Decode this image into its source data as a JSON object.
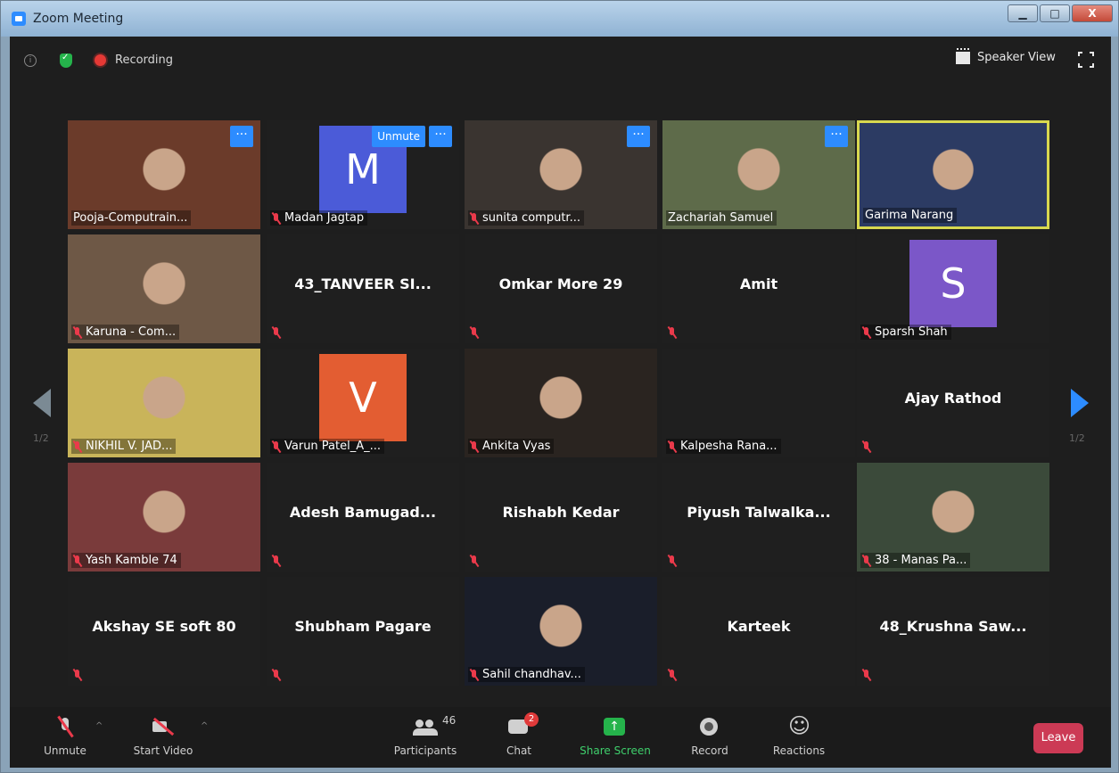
{
  "window": {
    "title": "Zoom Meeting",
    "controls": {
      "minimize": "▁",
      "maximize": "□",
      "close": "X"
    }
  },
  "topbar": {
    "recording_label": "Recording",
    "speaker_view_label": "Speaker View"
  },
  "gallery": {
    "page_indicator_left": "1/2",
    "page_indicator_right": "1/2",
    "tiles": [
      {
        "name": "Pooja-Computrain...",
        "kind": "video",
        "muted": false,
        "more": true,
        "bg": "#6b3b2a"
      },
      {
        "name": "Madan Jagtap",
        "kind": "avatar",
        "letter": "M",
        "color": "#4b5bd8",
        "muted": true,
        "more": true,
        "unmute": "Unmute"
      },
      {
        "name": "sunita computr...",
        "kind": "video",
        "muted": true,
        "more": true,
        "bg": "#3a3430"
      },
      {
        "name": "Zachariah Samuel",
        "kind": "video",
        "muted": false,
        "more": true,
        "bg": "#5e6b4a"
      },
      {
        "name": "Garima Narang",
        "kind": "video",
        "muted": false,
        "more": false,
        "active": true,
        "bg": "#2c3b63"
      },
      {
        "name": "Karuna - Com...",
        "kind": "video",
        "muted": true,
        "more": false,
        "bg": "#6e5846"
      },
      {
        "name": "43_TANVEER SI...",
        "kind": "name",
        "muted": true
      },
      {
        "name": "Omkar More 29",
        "kind": "name",
        "muted": true
      },
      {
        "name": "Amit",
        "kind": "name",
        "muted": true
      },
      {
        "name": "Sparsh Shah",
        "kind": "avatar",
        "letter": "S",
        "color": "#7b57c8",
        "muted": true
      },
      {
        "name": "NIKHIL V. JAD...",
        "kind": "video",
        "muted": true,
        "more": false,
        "bg": "#c9b45a"
      },
      {
        "name": "Varun Patel_A_...",
        "kind": "avatar",
        "letter": "V",
        "color": "#e35d32",
        "muted": true
      },
      {
        "name": "Ankita Vyas",
        "kind": "video",
        "muted": true,
        "more": false,
        "bg": "#2a2420"
      },
      {
        "name": "Kalpesha Rana...",
        "kind": "blank",
        "muted": true
      },
      {
        "name": "Ajay Rathod",
        "kind": "name",
        "muted": true
      },
      {
        "name": "Yash Kamble 74",
        "kind": "video",
        "muted": true,
        "more": false,
        "bg": "#7a3b3b"
      },
      {
        "name": "Adesh  Bamugad...",
        "kind": "name",
        "muted": true
      },
      {
        "name": "Rishabh Kedar",
        "kind": "name",
        "muted": true
      },
      {
        "name": "Piyush  Talwalka...",
        "kind": "name",
        "muted": true
      },
      {
        "name": "38 - Manas Pa...",
        "kind": "video",
        "muted": true,
        "more": false,
        "bg": "#3b4a3a"
      },
      {
        "name": "Akshay SE soft 80",
        "kind": "name",
        "muted": true
      },
      {
        "name": "Shubham Pagare",
        "kind": "name",
        "muted": true
      },
      {
        "name": "Sahil chandhav...",
        "kind": "video",
        "muted": true,
        "more": false,
        "bg": "#1a1e2a"
      },
      {
        "name": "Karteek",
        "kind": "name",
        "muted": true
      },
      {
        "name": "48_Krushna  Saw...",
        "kind": "name",
        "muted": true
      }
    ]
  },
  "toolbar": {
    "unmute": "Unmute",
    "start_video": "Start Video",
    "participants": "Participants",
    "participants_count": "46",
    "chat": "Chat",
    "chat_badge": "2",
    "share_screen": "Share Screen",
    "record": "Record",
    "reactions": "Reactions",
    "leave": "Leave"
  }
}
